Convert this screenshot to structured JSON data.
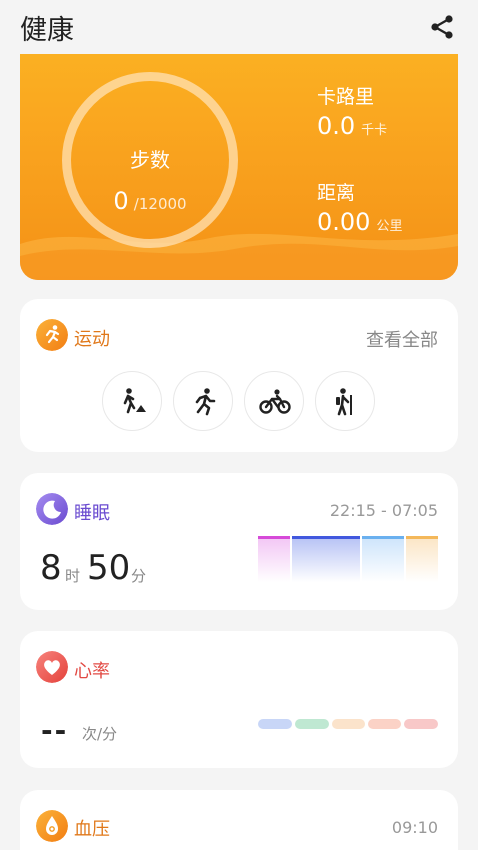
{
  "app": {
    "title": "健康"
  },
  "hero": {
    "steps_label": "步数",
    "steps_value": "0",
    "steps_goal": "/12000",
    "steps_progress": 0,
    "calories_label": "卡路里",
    "calories_value": "0.0",
    "calories_unit": "千卡",
    "distance_label": "距离",
    "distance_value": "0.00",
    "distance_unit": "公里"
  },
  "exercise": {
    "title": "运动",
    "view_all": "查看全部",
    "activities": [
      "walking-icon",
      "running-icon",
      "cycling-icon",
      "hiking-icon"
    ]
  },
  "sleep": {
    "title": "睡眠",
    "time_range": "22:15 - 07:05",
    "hours": "8",
    "hours_unit": "时",
    "minutes": "50",
    "minutes_unit": "分"
  },
  "heart": {
    "title": "心率",
    "value": "--",
    "unit": "次/分"
  },
  "bp": {
    "title": "血压",
    "time": "09:10"
  },
  "colors": {
    "accent_orange": "#f7a11f",
    "sleep_purple": "#7a5fd0",
    "heart_red": "#e8534e"
  }
}
